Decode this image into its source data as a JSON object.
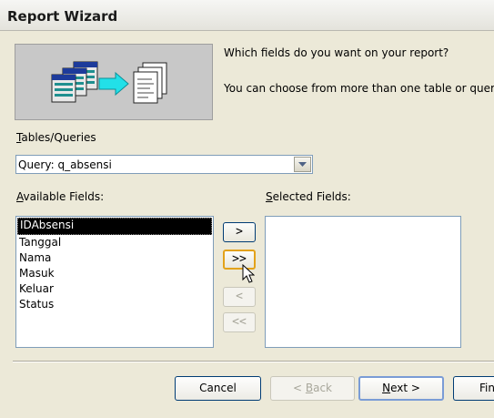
{
  "window": {
    "title": "Report Wizard"
  },
  "prompt": {
    "question": "Which fields do you want on your report?",
    "hint": "You can choose from more than one table or query."
  },
  "tables_queries": {
    "label_mnemonic": "T",
    "label_rest": "ables/Queries",
    "selected": "Query: q_absensi"
  },
  "available_fields": {
    "label_mnemonic": "A",
    "label_rest": "vailable Fields:",
    "items": [
      "IDAbsensi",
      "Tanggal",
      "Nama",
      "Masuk",
      "Keluar",
      "Status"
    ],
    "selected_index": 0
  },
  "selected_fields": {
    "label_mnemonic": "S",
    "label_rest": "elected Fields:",
    "items": []
  },
  "move_buttons": {
    "add_one": ">",
    "add_all": ">>",
    "remove_one": "<",
    "remove_all": "<<"
  },
  "footer": {
    "cancel": "Cancel",
    "back_prefix": "< ",
    "back_mnemonic": "B",
    "back_rest": "ack",
    "next_mnemonic": "N",
    "next_rest": "ext >",
    "finish_partial": "Fin"
  },
  "icons": {
    "dropdown": "chevron-down-icon",
    "cursor": "mouse-pointer-icon",
    "illustration": "report-wizard-illustration"
  }
}
